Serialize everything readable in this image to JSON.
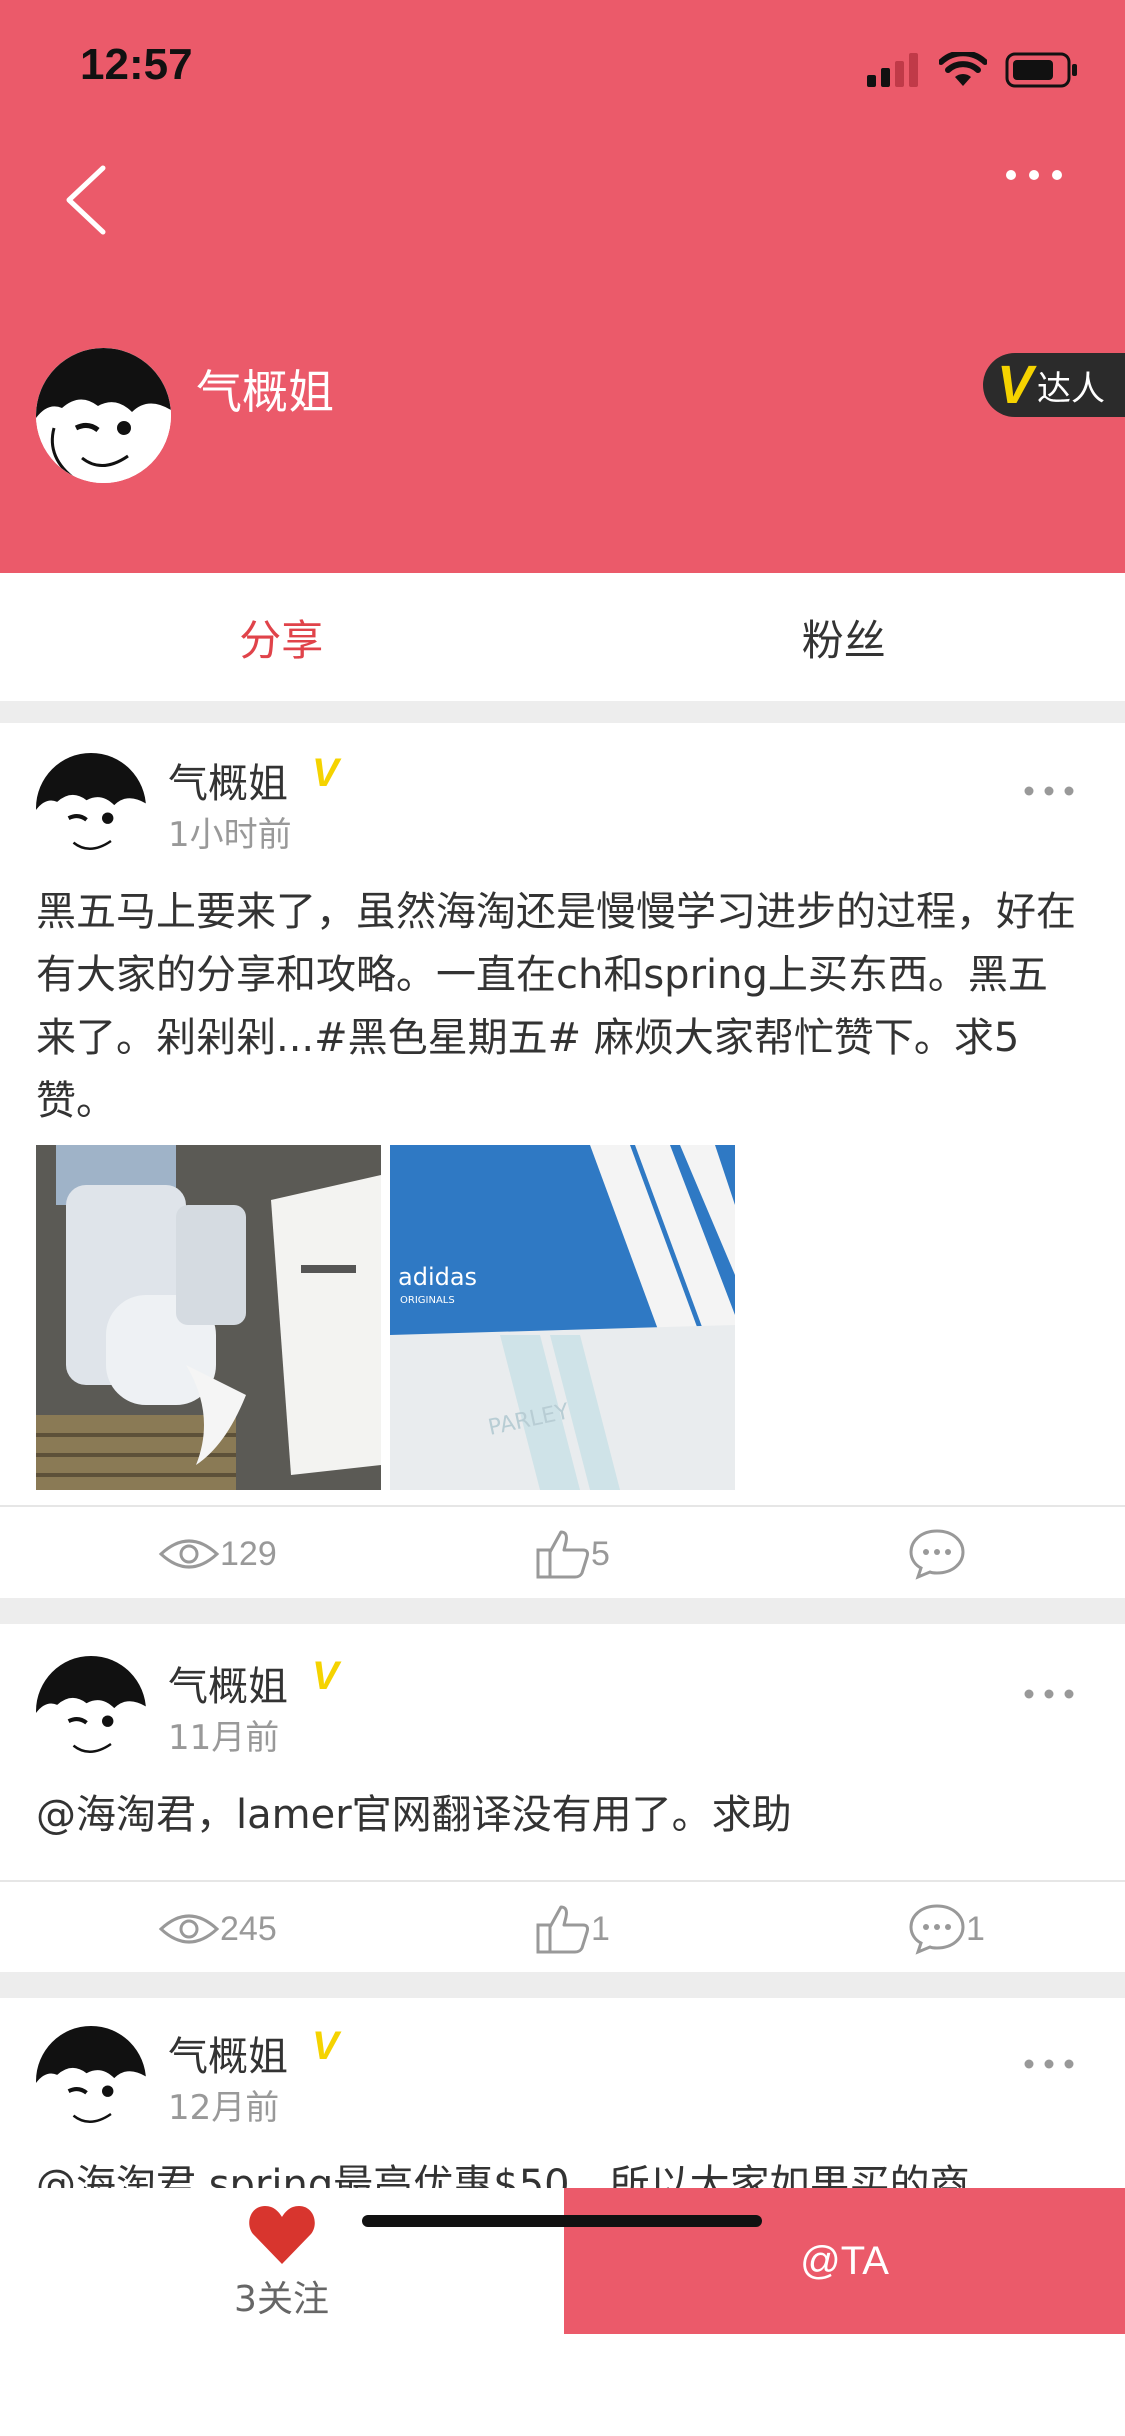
{
  "status_bar": {
    "time": "12:57"
  },
  "header": {
    "username": "气概姐",
    "badge_v": "V",
    "badge_label": "达人"
  },
  "tabs": [
    {
      "label": "分享",
      "active": true
    },
    {
      "label": "粉丝",
      "active": false
    }
  ],
  "posts": [
    {
      "author": "气概姐",
      "time": "1小时前",
      "body": "黑五马上要来了，虽然海淘还是慢慢学习进步的过程，好在有大家的分享和攻略。一直在ch和spring上买东西。黑五来了。剁剁剁...#黑色星期五# 麻烦大家帮忙赞下。求5赞。",
      "photo_brand": "adidas",
      "photo_sub": "ORIGINALS",
      "photo_tag": "PARLEY",
      "views": "129",
      "likes": "5",
      "comments": ""
    },
    {
      "author": "气概姐",
      "time": "11月前",
      "body": "@海淘君，lamer官网翻译没有用了。求助",
      "views": "245",
      "likes": "1",
      "comments": "1"
    },
    {
      "author": "气概姐",
      "time": "12月前",
      "body": "@海淘君 spring最高优惠$50，所以大家如果买的商"
    }
  ],
  "bottom_bar": {
    "follow_label": "3关注",
    "at_label": "@TA"
  },
  "colors": {
    "brand": "#EB5A6A",
    "active_tab": "#E0434A",
    "verified": "#F5D300"
  }
}
